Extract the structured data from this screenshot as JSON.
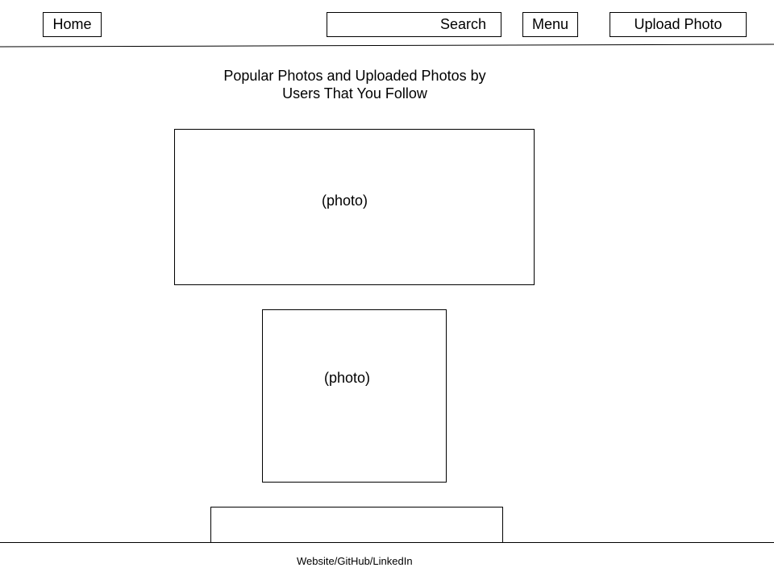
{
  "nav": {
    "home_label": "Home",
    "search_placeholder": "Search",
    "menu_label": "Menu",
    "upload_label": "Upload Photo"
  },
  "feed": {
    "heading_line1": "Popular Photos and Uploaded Photos by",
    "heading_line2": "Users That You Follow",
    "photos": [
      {
        "label": "(photo)"
      },
      {
        "label": "(photo)"
      },
      {
        "label": ""
      }
    ]
  },
  "footer": {
    "links_label": "Website/GitHub/LinkedIn"
  }
}
